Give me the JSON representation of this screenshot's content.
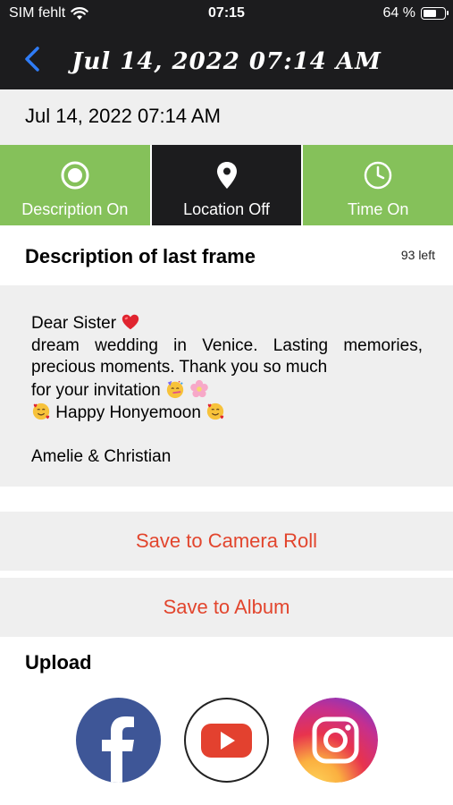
{
  "status_bar": {
    "carrier": "SIM fehlt",
    "time": "07:15",
    "battery": "64 %",
    "battery_level": 0.64,
    "icons": [
      "wifi-icon",
      "battery-icon"
    ]
  },
  "nav": {
    "back_icon": "chevron-left-icon",
    "title": "Jul 14, 2022 07:14 AM",
    "accent_color": "#2f7cf6"
  },
  "date_display": "Jul 14, 2022 07:14 AM",
  "toggles": [
    {
      "label": "Description On",
      "icon": "radio-icon",
      "state": "on"
    },
    {
      "label": "Location Off",
      "icon": "location-pin-icon",
      "state": "off"
    },
    {
      "label": "Time On",
      "icon": "clock-icon",
      "state": "on"
    }
  ],
  "toggle_colors": {
    "on": "#85c15a",
    "off": "#1c1c1e"
  },
  "description": {
    "heading": "Description of last frame",
    "remaining": "93 left",
    "lines": [
      "Dear Sister",
      "dream wedding in Venice. Lasting memories,",
      "precious moments. Thank you so much",
      "for your invitation",
      "Happy Honyemoon",
      "",
      "Amelie & Christian"
    ]
  },
  "actions": {
    "save_camera_roll": "Save to Camera Roll",
    "save_album": "Save to Album",
    "action_color": "#e2452d"
  },
  "upload": {
    "title": "Upload",
    "services": [
      "facebook-icon",
      "youtube-icon",
      "instagram-icon"
    ]
  }
}
